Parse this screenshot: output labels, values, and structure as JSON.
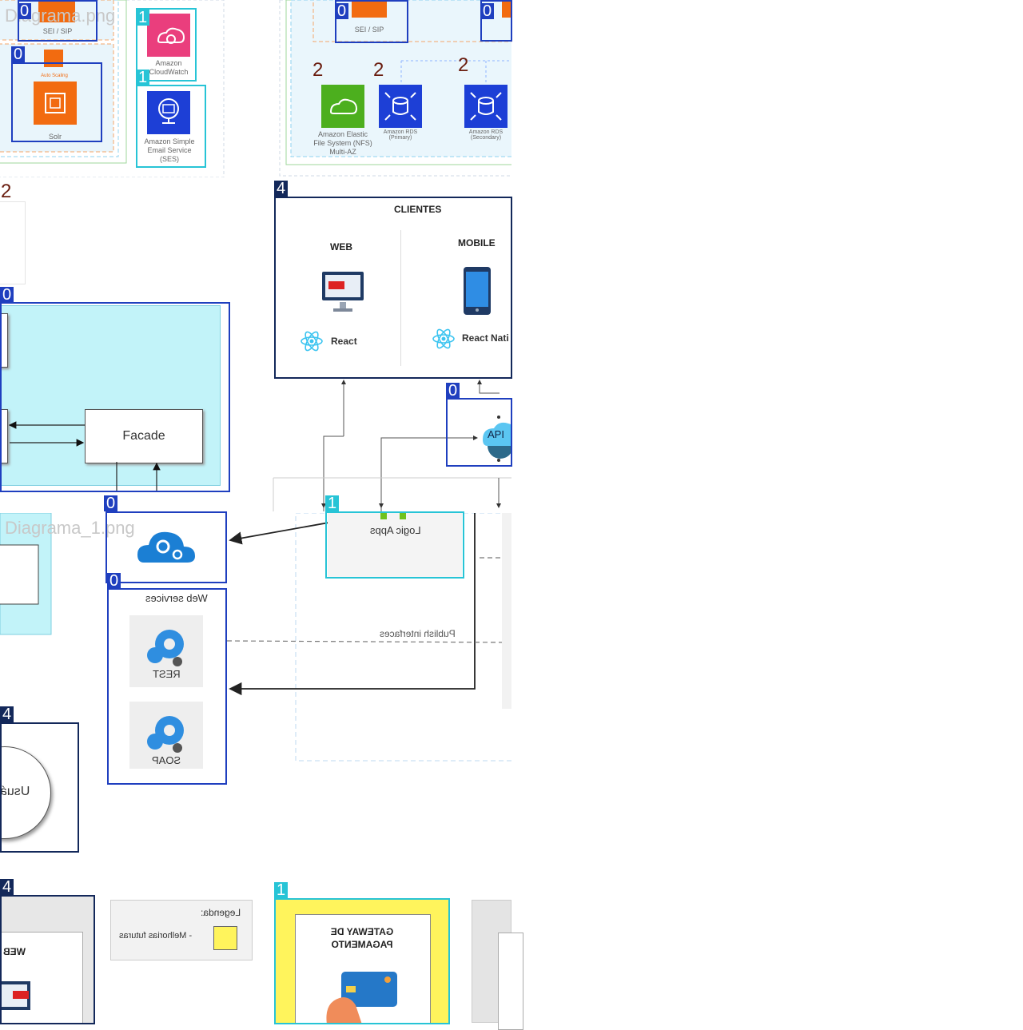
{
  "tiles": {
    "aws_left": {
      "watermark": "Diagrama.png",
      "sei_label": "SEI / SIP",
      "autoscaling_label": "Auto Scaling",
      "solr_label": "Solr",
      "cloudwatch_label": "Amazon CloudWatch",
      "ses_label": "Amazon Simple Email Service (SES)"
    },
    "aws_right": {
      "sei_label": "SEI / SIP",
      "efs_label": "Amazon Elastic File System (NFS) Multi-AZ",
      "rds_primary_label": "Amazon RDS (Primary)",
      "rds_secondary_label": "Amazon RDS (Secondary)"
    },
    "facade": {
      "facade_label": "Facade"
    },
    "clients": {
      "title": "CLIENTES",
      "web_label": "WEB",
      "mobile_label": "MOBILE",
      "react_label": "React",
      "react_native_label": "React Nati",
      "api_label": "API"
    },
    "mirrored": {
      "watermark": "Diagrama_1.png",
      "logic_apps_label": "Logic Apps",
      "web_services_label": "Web services",
      "rest_label": "REST",
      "soap_label": "SOAP",
      "publish_label": "Publish interfaces",
      "usuario_label": "Usuá",
      "legend_title": "Legenda:",
      "legend_item": "- Melhorias futuras",
      "web_label": "WEB",
      "gateway_label": "GATEWAY DE PAGAMENTO"
    }
  },
  "badges": [
    "0",
    "1",
    "2",
    "4"
  ],
  "colors": {
    "box_blue": "#1f3fbf",
    "box_cyan": "#27c4d6",
    "box_navy": "#13285a",
    "badge_red": "#6a1d0f",
    "aws_orange": "#f26b10",
    "aws_pink": "#ea3e7d",
    "aws_green": "#4caf1e",
    "aws_blue": "#1d3fd6",
    "facade_bg": "#c2f3f9",
    "gateway_yellow": "#fff45c"
  }
}
